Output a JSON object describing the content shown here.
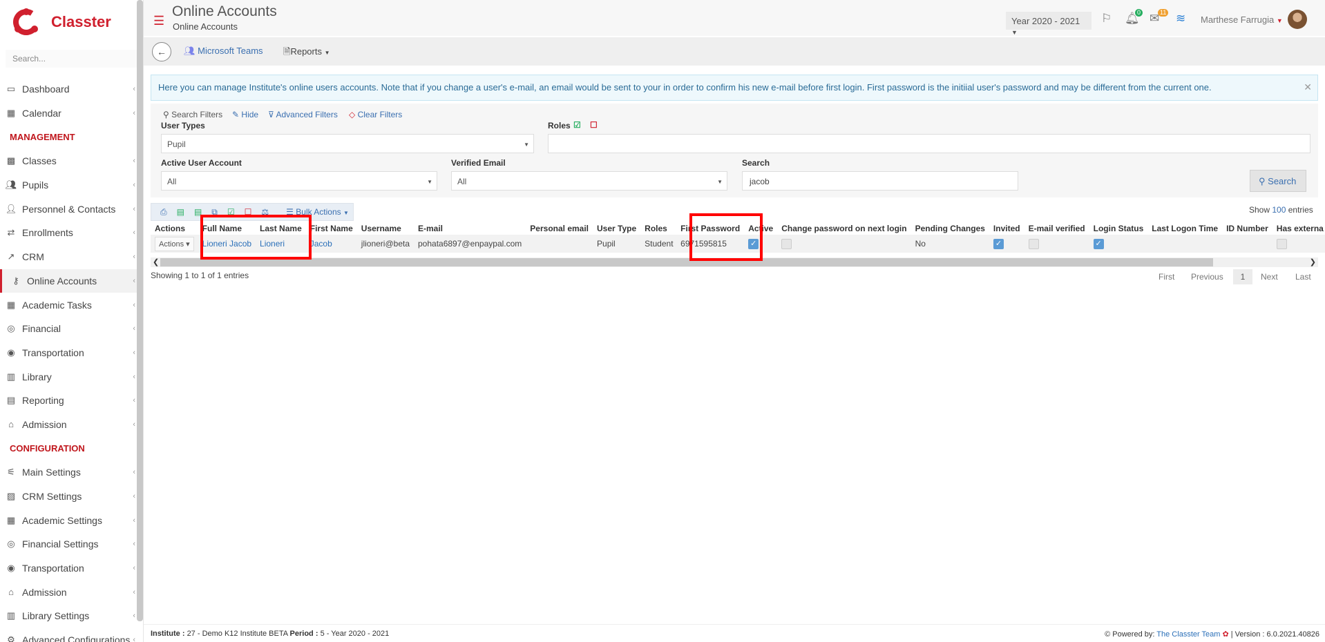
{
  "app": {
    "name": "Classter",
    "sidebar_search_placeholder": "Search...",
    "brand_color": "#d0202e"
  },
  "sidebar": {
    "top_items": [
      {
        "label": "Dashboard",
        "icon": "laptop-icon"
      },
      {
        "label": "Calendar",
        "icon": "calendar-icon"
      }
    ],
    "management_title": "MANAGEMENT",
    "management_items": [
      {
        "label": "Classes",
        "icon": "classes-icon"
      },
      {
        "label": "Pupils",
        "icon": "pupils-icon"
      },
      {
        "label": "Personnel & Contacts",
        "icon": "personnel-icon"
      },
      {
        "label": "Enrollments",
        "icon": "enrollments-icon"
      },
      {
        "label": "CRM",
        "icon": "crm-icon"
      },
      {
        "label": "Online Accounts",
        "icon": "key-icon",
        "active": true
      },
      {
        "label": "Academic Tasks",
        "icon": "grid-icon"
      },
      {
        "label": "Financial",
        "icon": "coins-icon"
      },
      {
        "label": "Transportation",
        "icon": "bus-icon"
      },
      {
        "label": "Library",
        "icon": "books-icon"
      },
      {
        "label": "Reporting",
        "icon": "report-icon"
      },
      {
        "label": "Admission",
        "icon": "institution-icon"
      }
    ],
    "configuration_title": "CONFIGURATION",
    "configuration_items": [
      {
        "label": "Main Settings",
        "icon": "sliders-icon"
      },
      {
        "label": "CRM Settings",
        "icon": "crm-settings-icon"
      },
      {
        "label": "Academic Settings",
        "icon": "grid-icon"
      },
      {
        "label": "Financial Settings",
        "icon": "coins-icon"
      },
      {
        "label": "Transportation",
        "icon": "bus-icon"
      },
      {
        "label": "Admission",
        "icon": "institution-icon"
      },
      {
        "label": "Library Settings",
        "icon": "books-icon"
      },
      {
        "label": "Advanced Configurations",
        "icon": "gears-icon"
      }
    ]
  },
  "header": {
    "title": "Online Accounts",
    "subtitle": "Online Accounts",
    "year_selector": "Year 2020 - 2021",
    "notifications_count": "0",
    "messages_count": "11",
    "user_name": "Marthese Farrugia"
  },
  "toolbar": {
    "teams_label": "Microsoft Teams",
    "reports_label": "Reports"
  },
  "info_text": "Here you can manage Institute's online users accounts. Note that if you change a user's e-mail, an email would be sent to your in order to confirm his new e-mail before first login. First password is the initiial user's password and may be different from the current one.",
  "filters": {
    "search_filters_label": "Search Filters",
    "hide_label": "Hide",
    "advanced_label": "Advanced Filters",
    "clear_label": "Clear Filters",
    "user_types_label": "User Types",
    "user_types_value": "Pupil",
    "roles_label": "Roles",
    "active_label": "Active User Account",
    "active_value": "All",
    "verified_label": "Verified Email",
    "verified_value": "All",
    "search_label": "Search",
    "search_value": "jacob",
    "search_button": "Search"
  },
  "bulk_actions_label": "Bulk Actions",
  "show_entries": {
    "prefix": "Show",
    "count": "100",
    "suffix": "entries"
  },
  "table": {
    "headers": [
      "Actions",
      "Full Name",
      "Last Name",
      "First Name",
      "Username",
      "E-mail",
      "Personal email",
      "User Type",
      "Roles",
      "First Password",
      "Active",
      "Change password on next login",
      "Pending Changes",
      "Invited",
      "E-mail verified",
      "Login Status",
      "Last Logon Time",
      "ID Number",
      "Has externa"
    ],
    "rows": [
      {
        "actions": "Actions",
        "full_name": "Lioneri Jacob",
        "last_name": "Lioneri",
        "first_name": "Jacob",
        "username": "jlioneri@beta",
        "email": "pohata6897@enpaypal.com",
        "personal_email": "",
        "user_type": "Pupil",
        "roles": "Student",
        "first_password": "6971595815",
        "active": true,
        "change_password": false,
        "pending_changes": "No",
        "invited": true,
        "email_verified": false,
        "login_status": true,
        "last_logon": "",
        "id_number": "",
        "has_external": false
      }
    ]
  },
  "showing_text": "Showing 1 to 1 of 1 entries",
  "pager": {
    "first": "First",
    "previous": "Previous",
    "current": "1",
    "next": "Next",
    "last": "Last"
  },
  "footer": {
    "institute_label": "Institute :",
    "institute_value": "27 - Demo K12 Institute BETA",
    "period_label": "Period :",
    "period_value": "5 - Year 2020 - 2021",
    "powered_label": "Powered by:",
    "powered_value": "The Classter Team",
    "version_text": "| Version : 6.0.2021.40826"
  }
}
